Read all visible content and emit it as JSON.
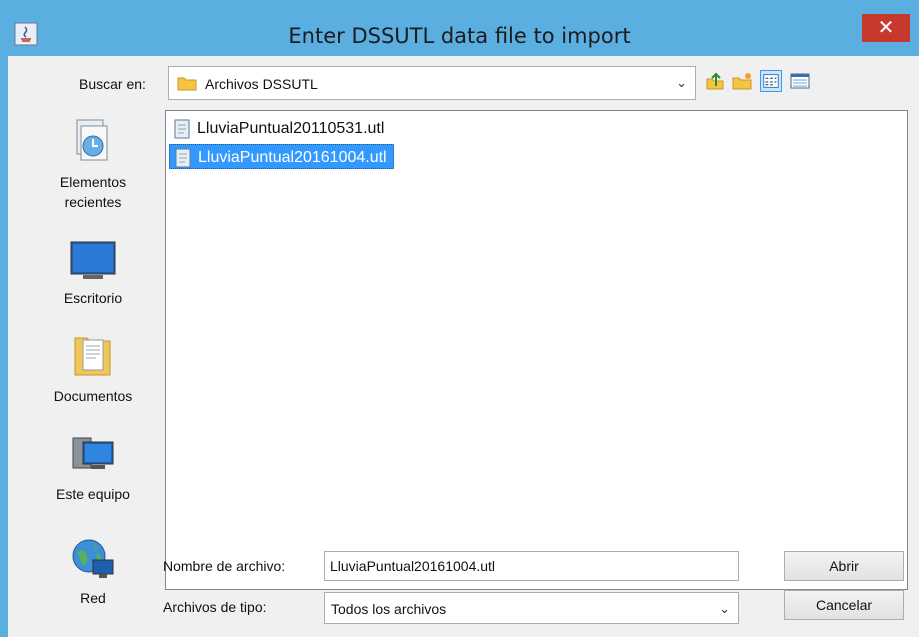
{
  "window": {
    "title": "Enter DSSUTL data file to import",
    "close_glyph": "✕"
  },
  "lookin": {
    "label": "Buscar en:",
    "value": "Archivos DSSUTL",
    "chevron": "⌄",
    "folder_icon": "folder-icon"
  },
  "toolbar": {
    "icons": [
      "up-folder-icon",
      "new-folder-icon",
      "list-view-icon",
      "details-view-icon"
    ]
  },
  "places": [
    {
      "label1": "Elementos",
      "label2": "recientes",
      "icon": "recent-items-icon"
    },
    {
      "label1": "Escritorio",
      "label2": "",
      "icon": "desktop-icon"
    },
    {
      "label1": "Documentos",
      "label2": "",
      "icon": "documents-icon"
    },
    {
      "label1": "Este equipo",
      "label2": "",
      "icon": "computer-icon"
    },
    {
      "label1": "Red",
      "label2": "",
      "icon": "network-icon"
    }
  ],
  "files": [
    {
      "name": "LluviaPuntual20110531.utl",
      "selected": false
    },
    {
      "name": "LluviaPuntual20161004.utl",
      "selected": true
    }
  ],
  "filename": {
    "label": "Nombre de archivo:",
    "value": "LluviaPuntual20161004.utl"
  },
  "filetype": {
    "label": "Archivos de tipo:",
    "value": "Todos los archivos",
    "chevron": "⌄"
  },
  "buttons": {
    "open": "Abrir",
    "cancel": "Cancelar"
  },
  "colors": {
    "titlebar": "#5aaee0",
    "close": "#c7382d",
    "selection": "#3399ff"
  }
}
